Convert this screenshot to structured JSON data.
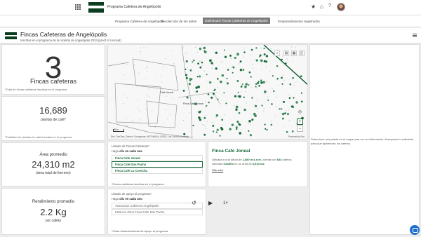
{
  "app": {
    "title": "Programa Cafetera de Angelópolis"
  },
  "nav": {
    "tabs": [
      {
        "label": "Programa Cafetera de Angelópolis",
        "active": false
      },
      {
        "label": "Recolección de los datos",
        "active": false
      },
      {
        "label": "Dashboard Fincas Cafeteras de Angelópolis",
        "active": true
      },
      {
        "label": "Emprendimientos registrados",
        "active": false
      }
    ]
  },
  "header": {
    "title": "Fincas Cafeteras de Angelópolis",
    "subtitle": "Inscritas en el programa de la Alcaldía de Angelópolis 2024 (proof of concept)"
  },
  "kpis": {
    "fincas": {
      "value": "3",
      "label": "Fincas cafeteras",
      "footnote": "*Total de fincas cafeteras inscritas en el programa"
    },
    "plantas": {
      "value": "16,689",
      "label": "plantas de café*",
      "footnote": "*Totalidad de plantas de café inscritas en el programa"
    },
    "area": {
      "title": "Área promedio",
      "value": "24,310 m2",
      "label": "(área total del terreno)"
    },
    "rendimiento": {
      "title": "Rendimiento promedio",
      "value": "2.2 Kg",
      "label": "por cafeto"
    }
  },
  "map": {
    "labels": [
      "Cafe Joneal",
      "Finca Cafe Joneal"
    ],
    "scale": "80 m",
    "attribution": "Esri, TomTom, Garmin, Foursquare, METI/NASA, USGS, Los Cuervos Anzalgo",
    "powered": "Powered by Esri",
    "zoom_in": "+",
    "zoom_out": "−",
    "accent": "#1a6b3a"
  },
  "list": {
    "title": "Listado de Fincas Cafeteras*",
    "hint_pre": "Haga ",
    "hint_bold": "clic en cada una",
    "items": [
      "Finca Cafe Joneal",
      "Finca Cafe Don Pacho",
      "Finca Cafe La Cosecha"
    ],
    "footnote": "*Fincas cafeteras inscritas en el programa"
  },
  "support": {
    "title": "Listado de apoyo al programa*",
    "hint_pre": "Haga ",
    "hint_bold": "clic en cada uno",
    "items": [
      "Asociacion Cafeteros Angelópolis",
      "Estacion climo Finca Cafe Don Pacho"
    ],
    "footnote": "*Otras infraestructuras de apoyo al programa"
  },
  "detail": {
    "title": "Finca Cafe Joneal",
    "line1_pre": "Ubicada a una altura de ",
    "altura": "1,680 m.s.n.m.",
    "line1_mid": " cuenta con ",
    "cafetos": "644",
    "line1_post": " cafetos",
    "line2_pre": "variedad ",
    "variedad": "Castillo",
    "line2_mid": " en un área de ",
    "area": "6,810 m2",
    "link": "Sitio web"
  },
  "right_note": "Seleccione una planta en el mapa para ver su información. Acérquese lo suficiente para que aparezcan los cafetos.",
  "player": {
    "speed": "1×"
  }
}
